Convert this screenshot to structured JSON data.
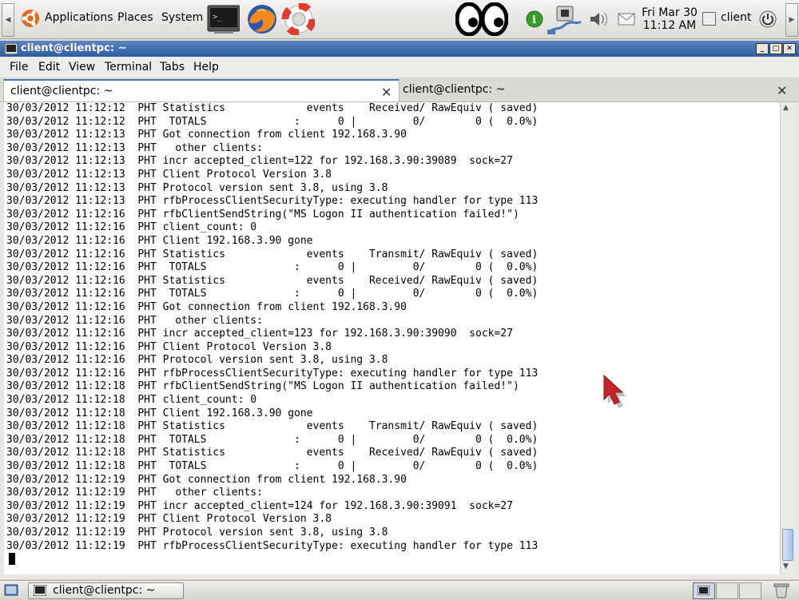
{
  "panel": {
    "menus": [
      "Applications",
      "Places",
      "System"
    ],
    "clock_date": "Fri Mar 30",
    "clock_time": "11:12 AM",
    "user": "client"
  },
  "window": {
    "title": "client@clientpc: ~",
    "menu": [
      "File",
      "Edit",
      "View",
      "Terminal",
      "Tabs",
      "Help"
    ],
    "tabs": [
      {
        "label": "client@clientpc: ~",
        "active": true
      },
      {
        "label": "client@clientpc: ~",
        "active": false
      }
    ]
  },
  "terminal": {
    "lines": [
      "30/03/2012 11:12:12  PHT Statistics             events    Received/ RawEquiv ( saved)",
      "30/03/2012 11:12:12  PHT  TOTALS              :      0 |         0/        0 (  0.0%)",
      "30/03/2012 11:12:13  PHT Got connection from client 192.168.3.90",
      "30/03/2012 11:12:13  PHT   other clients:",
      "30/03/2012 11:12:13  PHT incr accepted_client=122 for 192.168.3.90:39089  sock=27",
      "30/03/2012 11:12:13  PHT Client Protocol Version 3.8",
      "30/03/2012 11:12:13  PHT Protocol version sent 3.8, using 3.8",
      "30/03/2012 11:12:13  PHT rfbProcessClientSecurityType: executing handler for type 113",
      "30/03/2012 11:12:16  PHT rfbClientSendString(\"MS Logon II authentication failed!\")",
      "30/03/2012 11:12:16  PHT client_count: 0",
      "30/03/2012 11:12:16  PHT Client 192.168.3.90 gone",
      "30/03/2012 11:12:16  PHT Statistics             events    Transmit/ RawEquiv ( saved)",
      "30/03/2012 11:12:16  PHT  TOTALS              :      0 |         0/        0 (  0.0%)",
      "30/03/2012 11:12:16  PHT Statistics             events    Received/ RawEquiv ( saved)",
      "30/03/2012 11:12:16  PHT  TOTALS              :      0 |         0/        0 (  0.0%)",
      "30/03/2012 11:12:16  PHT Got connection from client 192.168.3.90",
      "30/03/2012 11:12:16  PHT   other clients:",
      "30/03/2012 11:12:16  PHT incr accepted_client=123 for 192.168.3.90:39090  sock=27",
      "30/03/2012 11:12:16  PHT Client Protocol Version 3.8",
      "30/03/2012 11:12:16  PHT Protocol version sent 3.8, using 3.8",
      "30/03/2012 11:12:16  PHT rfbProcessClientSecurityType: executing handler for type 113",
      "30/03/2012 11:12:18  PHT rfbClientSendString(\"MS Logon II authentication failed!\")",
      "30/03/2012 11:12:18  PHT client_count: 0",
      "30/03/2012 11:12:18  PHT Client 192.168.3.90 gone",
      "30/03/2012 11:12:18  PHT Statistics             events    Transmit/ RawEquiv ( saved)",
      "30/03/2012 11:12:18  PHT  TOTALS              :      0 |         0/        0 (  0.0%)",
      "30/03/2012 11:12:18  PHT Statistics             events    Received/ RawEquiv ( saved)",
      "30/03/2012 11:12:18  PHT  TOTALS              :      0 |         0/        0 (  0.0%)",
      "30/03/2012 11:12:19  PHT Got connection from client 192.168.3.90",
      "30/03/2012 11:12:19  PHT   other clients:",
      "30/03/2012 11:12:19  PHT incr accepted_client=124 for 192.168.3.90:39091  sock=27",
      "30/03/2012 11:12:19  PHT Client Protocol Version 3.8",
      "30/03/2012 11:12:19  PHT Protocol version sent 3.8, using 3.8",
      "30/03/2012 11:12:19  PHT rfbProcessClientSecurityType: executing handler for type 113"
    ]
  },
  "taskbar": {
    "task_label": "client@clientpc: ~"
  },
  "colors": {
    "titlebar": "#2e5d9f",
    "accent": "#4a78b8"
  }
}
